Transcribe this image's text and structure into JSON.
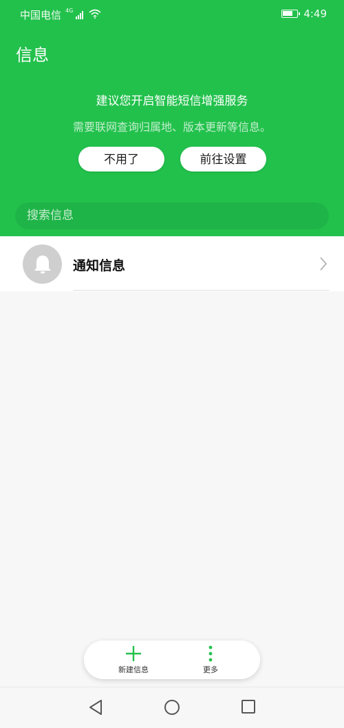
{
  "status_bar": {
    "carrier": "中国电信",
    "network_badge": "4G",
    "time": "4:49",
    "battery_level": 0.75
  },
  "header": {
    "title": "信息"
  },
  "promo": {
    "title": "建议您开启智能短信增强服务",
    "subtitle": "需要联网查询归属地、版本更新等信息。",
    "decline_label": "不用了",
    "accept_label": "前往设置"
  },
  "search": {
    "placeholder": "搜索信息"
  },
  "conversations": [
    {
      "label": "通知信息",
      "icon": "bell-icon"
    }
  ],
  "bottom_actions": {
    "new_label": "新建信息",
    "more_label": "更多"
  },
  "nav": {
    "back_icon": "back-triangle-icon",
    "home_icon": "home-circle-icon",
    "recent_icon": "recent-square-icon"
  },
  "colors": {
    "accent": "#22c14c",
    "search_bg": "#1fb447",
    "background": "#f7f7f7"
  }
}
